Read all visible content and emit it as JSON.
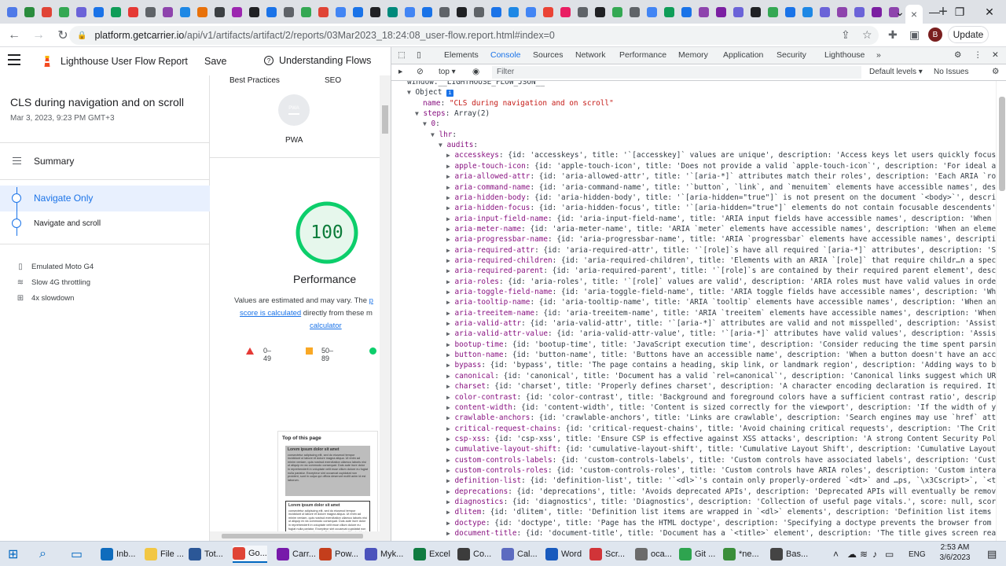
{
  "browser": {
    "url_host": "platform.getcarrier.io",
    "url_path": "/api/v1/artifacts/artifact/2/reports/03Mar2023_18:24:08_user-flow.report.html#index=0",
    "update_label": "Update",
    "profile_initial": "B",
    "tab_favicon_colors": [
      "#4f7ae8",
      "#2a8c3d",
      "#e04436",
      "#34a853",
      "#6b63d8",
      "#1a73e8",
      "#0f9d58",
      "#e53935",
      "#5f6368",
      "#8e44ad",
      "#1e88e5",
      "#e8710a",
      "#3c4043",
      "#9c27b0",
      "#202124",
      "#1a73e8",
      "#5f6368",
      "#34a853",
      "#e04436",
      "#4285f4",
      "#1a73e8",
      "#202124",
      "#00897b",
      "#4285f4",
      "#1a73e8",
      "#5f6368",
      "#202124",
      "#5f6368",
      "#1a73e8",
      "#1e88e5",
      "#4285f4",
      "#ea4335",
      "#e91e63",
      "#5f6368",
      "#202124",
      "#34a853",
      "#5f6368",
      "#4285f4",
      "#0f9d58",
      "#1a73e8",
      "#8e44ad",
      "#7b1fa2",
      "#6b63d8",
      "#202124",
      "#34a853",
      "#1a73e8",
      "#1e88e5",
      "#6b63d8",
      "#8e44ad",
      "#6b63d8",
      "#7b1fa2",
      "#8e44ad"
    ],
    "new_tab_icon": "+",
    "close_tab_icon": "×"
  },
  "report": {
    "header": {
      "title": "Lighthouse User Flow Report",
      "save_label": "Save",
      "understanding_label": "Understanding Flows"
    },
    "sidebar": {
      "flow_name": "CLS during navigation and on scroll",
      "flow_date": "Mar 3, 2023, 9:23 PM GMT+3",
      "summary_label": "Summary",
      "steps": [
        {
          "label": "Navigate Only"
        },
        {
          "label": "Navigate and scroll"
        }
      ],
      "env": [
        {
          "icon": "device-icon",
          "label": "Emulated Moto G4"
        },
        {
          "icon": "network-icon",
          "label": "Slow 4G throttling"
        },
        {
          "icon": "cpu-icon",
          "label": "4x slowdown"
        }
      ]
    },
    "main": {
      "category_best_practices": "Best Practices",
      "category_seo": "SEO",
      "pwa_badge_text": "PWA",
      "pwa_label": "PWA",
      "perf_score": "100",
      "perf_label": "Performance",
      "values_text_1": "Values are estimated and may vary. The ",
      "values_link_1": "p",
      "values_link_2": "score is calculated",
      "values_text_2": " directly from these m",
      "values_link_3": "calculator",
      "legend": [
        {
          "range": "0–49",
          "color": "#e53935"
        },
        {
          "range": "50–89",
          "color": "#f9a825"
        },
        {
          "range": "",
          "color": "#0cce6b"
        }
      ],
      "thumb_title": "Top of this page",
      "thumb_heading": "Lorem ipsum dolor sit amet",
      "thumb_body": "consectetur adipiscing elit, sed do eiusmod tempor incididunt ut labore et dolore magna aliqua. Ut enim ad minim veniam, quis nostrud exercitation ullamco laboris nisi ut aliquip ex ea commodo consequat. Duis aute irure dolor in reprehenderit in voluptate velit esse cillum dolore eu fugiat nulla pariatur. Excepteur sint occaecat cupidatat non proident, sunt in culpa qui officia deserunt mollit anim id est laborum."
    }
  },
  "devtools": {
    "tabs": [
      "Elements",
      "Console",
      "Sources",
      "Network",
      "Performance",
      "Memory",
      "Application",
      "Security",
      "Lighthouse"
    ],
    "active_tab": "Console",
    "context": "top",
    "filter_placeholder": "Filter",
    "levels": "Default levels",
    "issues": "No Issues",
    "header_line": "window.__LIGHTHOUSE_FLOW_JSON__",
    "object_label": "Object",
    "name_key": "name",
    "name_value": "\"CLS during navigation and on scroll\"",
    "steps_key": "steps",
    "steps_value": "Array(2)",
    "index_key": "0",
    "lhr_key": "lhr",
    "audits_key": "audits",
    "audits": [
      {
        "key": "accesskeys",
        "rest": "{id: 'accesskeys', title: '`[accesskey]` values are unique', description: 'Access keys let users quickly focus"
      },
      {
        "key": "apple-touch-icon",
        "rest": "{id: 'apple-touch-icon', title: 'Does not provide a valid `apple-touch-icon`', description: 'For ideal a"
      },
      {
        "key": "aria-allowed-attr",
        "rest": "{id: 'aria-allowed-attr', title: '`[aria-*]` attributes match their roles', description: 'Each ARIA `ro"
      },
      {
        "key": "aria-command-name",
        "rest": "{id: 'aria-command-name', title: '`button`, `link`, and `menuitem` elements have accessible names', des"
      },
      {
        "key": "aria-hidden-body",
        "rest": "{id: 'aria-hidden-body', title: '`[aria-hidden=\"true\"]` is not present on the document `<body>`', descri"
      },
      {
        "key": "aria-hidden-focus",
        "rest": "{id: 'aria-hidden-focus', title: '`[aria-hidden=\"true\"]` elements do not contain focusable descendents'"
      },
      {
        "key": "aria-input-field-name",
        "rest": "{id: 'aria-input-field-name', title: 'ARIA input fields have accessible names', description: 'When"
      },
      {
        "key": "aria-meter-name",
        "rest": "{id: 'aria-meter-name', title: 'ARIA `meter` elements have accessible names', description: 'When an eleme"
      },
      {
        "key": "aria-progressbar-name",
        "rest": "{id: 'aria-progressbar-name', title: 'ARIA `progressbar` elements have accessible names', description:"
      },
      {
        "key": "aria-required-attr",
        "rest": "{id: 'aria-required-attr', title: '`[role]`s have all required `[aria-*]` attributes', description: 'S"
      },
      {
        "key": "aria-required-children",
        "rest": "{id: 'aria-required-children', title: 'Elements with an ARIA `[role]` that require childr…n a spec"
      },
      {
        "key": "aria-required-parent",
        "rest": "{id: 'aria-required-parent', title: '`[role]`s are contained by their required parent element', descri"
      },
      {
        "key": "aria-roles",
        "rest": "{id: 'aria-roles', title: '`[role]` values are valid', description: 'ARIA roles must have valid values in orde"
      },
      {
        "key": "aria-toggle-field-name",
        "rest": "{id: 'aria-toggle-field-name', title: 'ARIA toggle fields have accessible names', description: 'Wh"
      },
      {
        "key": "aria-tooltip-name",
        "rest": "{id: 'aria-tooltip-name', title: 'ARIA `tooltip` elements have accessible names', description: 'When an"
      },
      {
        "key": "aria-treeitem-name",
        "rest": "{id: 'aria-treeitem-name', title: 'ARIA `treeitem` elements have accessible names', description: 'When"
      },
      {
        "key": "aria-valid-attr",
        "rest": "{id: 'aria-valid-attr', title: '`[aria-*]` attributes are valid and not misspelled', description: 'Assist"
      },
      {
        "key": "aria-valid-attr-value",
        "rest": "{id: 'aria-valid-attr-value', title: '`[aria-*]` attributes have valid values', description: 'Assis"
      },
      {
        "key": "bootup-time",
        "rest": "{id: 'bootup-time', title: 'JavaScript execution time', description: 'Consider reducing the time spent parsin"
      },
      {
        "key": "button-name",
        "rest": "{id: 'button-name', title: 'Buttons have an accessible name', description: 'When a button doesn't have an acc"
      },
      {
        "key": "bypass",
        "rest": "{id: 'bypass', title: 'The page contains a heading, skip link, or landmark region', description: 'Adding ways to b"
      },
      {
        "key": "canonical",
        "rest": "{id: 'canonical', title: 'Document has a valid `rel=canonical`', description: 'Canonical links suggest which UR"
      },
      {
        "key": "charset",
        "rest": "{id: 'charset', title: 'Properly defines charset', description: 'A character encoding declaration is required. It"
      },
      {
        "key": "color-contrast",
        "rest": "{id: 'color-contrast', title: 'Background and foreground colors have a sufficient contrast ratio', description"
      },
      {
        "key": "content-width",
        "rest": "{id: 'content-width', title: 'Content is sized correctly for the viewport', description: 'If the width of y"
      },
      {
        "key": "crawlable-anchors",
        "rest": "{id: 'crawlable-anchors', title: 'Links are crawlable', description: 'Search engines may use `href` att"
      },
      {
        "key": "critical-request-chains",
        "rest": "{id: 'critical-request-chains', title: 'Avoid chaining critical requests', description: 'The Crit"
      },
      {
        "key": "csp-xss",
        "rest": "{id: 'csp-xss', title: 'Ensure CSP is effective against XSS attacks', description: 'A strong Content Security Pol"
      },
      {
        "key": "cumulative-layout-shift",
        "rest": "{id: 'cumulative-layout-shift', title: 'Cumulative Layout Shift', description: 'Cumulative Layout"
      },
      {
        "key": "custom-controls-labels",
        "rest": "{id: 'custom-controls-labels', title: 'Custom controls have associated labels', description: 'Cust"
      },
      {
        "key": "custom-controls-roles",
        "rest": "{id: 'custom-controls-roles', title: 'Custom controls have ARIA roles', description: 'Custom intera"
      },
      {
        "key": "definition-list",
        "rest": "{id: 'definition-list', title: '`<dl>`'s contain only properly-ordered `<dt>` and …ps, `\\x3Cscript>`, `<t"
      },
      {
        "key": "deprecations",
        "rest": "{id: 'deprecations', title: 'Avoids deprecated APIs', description: 'Deprecated APIs will eventually be remov"
      },
      {
        "key": "diagnostics",
        "rest": "{id: 'diagnostics', title: 'Diagnostics', description: 'Collection of useful page vitals.', score: null, scor"
      },
      {
        "key": "dlitem",
        "rest": "{id: 'dlitem', title: 'Definition list items are wrapped in `<dl>` elements', description: 'Definition list items"
      },
      {
        "key": "doctype",
        "rest": "{id: 'doctype', title: 'Page has the HTML doctype', description: 'Specifying a doctype prevents the browser from"
      },
      {
        "key": "document-title",
        "rest": "{id: 'document-title', title: 'Document has a `<title>` element', description: 'The title gives screen rea"
      }
    ]
  },
  "taskbar": {
    "items": [
      {
        "label": "Inb...",
        "color": "#0f6cbd"
      },
      {
        "label": "File ...",
        "color": "#f2c744"
      },
      {
        "label": "Tot...",
        "color": "#2b5797"
      },
      {
        "label": "Go...",
        "color": "#e04436"
      },
      {
        "label": "Carr...",
        "color": "#7719aa"
      },
      {
        "label": "Pow...",
        "color": "#c43e1c"
      },
      {
        "label": "Myk...",
        "color": "#4b53bc"
      },
      {
        "label": "Excel",
        "color": "#107c41"
      },
      {
        "label": "Co...",
        "color": "#3c3c3c"
      },
      {
        "label": "Cal...",
        "color": "#5c6bc0"
      },
      {
        "label": "Word",
        "color": "#185abd"
      },
      {
        "label": "Scr...",
        "color": "#d13438"
      },
      {
        "label": "oca...",
        "color": "#6b6b6b"
      },
      {
        "label": "Git ...",
        "color": "#2ea44f"
      },
      {
        "label": "*ne...",
        "color": "#3a8e3a"
      },
      {
        "label": "Bas...",
        "color": "#444444"
      }
    ],
    "lang": "ENG",
    "time": "2:53 AM",
    "date": "3/6/2023"
  }
}
